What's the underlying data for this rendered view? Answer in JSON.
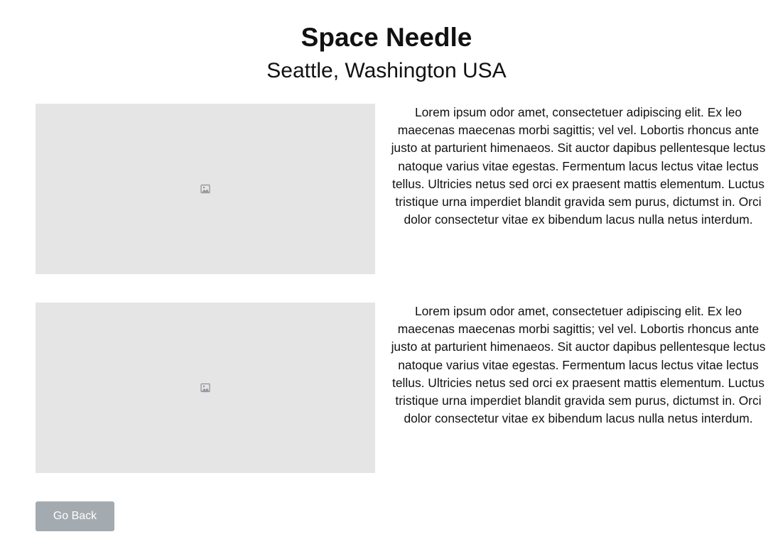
{
  "header": {
    "title": "Space Needle",
    "subtitle": "Seattle, Washington USA"
  },
  "sections": [
    {
      "image_icon": "image-icon",
      "text": "Lorem ipsum odor amet, consectetuer adipiscing elit. Ex leo maecenas maecenas morbi sagittis; vel vel. Lobortis rhoncus ante justo at parturient himenaeos. Sit auctor dapibus pellentesque lectus natoque varius vitae egestas. Fermentum lacus lectus vitae lectus tellus. Ultricies netus sed orci ex praesent mattis elementum. Luctus tristique urna imperdiet blandit gravida sem purus, dictumst in. Orci dolor consectetur vitae ex bibendum lacus nulla netus interdum."
    },
    {
      "image_icon": "image-icon",
      "text": "Lorem ipsum odor amet, consectetuer adipiscing elit. Ex leo maecenas maecenas morbi sagittis; vel vel. Lobortis rhoncus ante justo at parturient himenaeos. Sit auctor dapibus pellentesque lectus natoque varius vitae egestas. Fermentum lacus lectus vitae lectus tellus. Ultricies netus sed orci ex praesent mattis elementum. Luctus tristique urna imperdiet blandit gravida sem purus, dictumst in. Orci dolor consectetur vitae ex bibendum lacus nulla netus interdum."
    }
  ],
  "actions": {
    "go_back_label": "Go Back"
  },
  "colors": {
    "placeholder_bg": "#e5e5e5",
    "button_bg": "#a3aab0",
    "icon": "#8a9096"
  }
}
